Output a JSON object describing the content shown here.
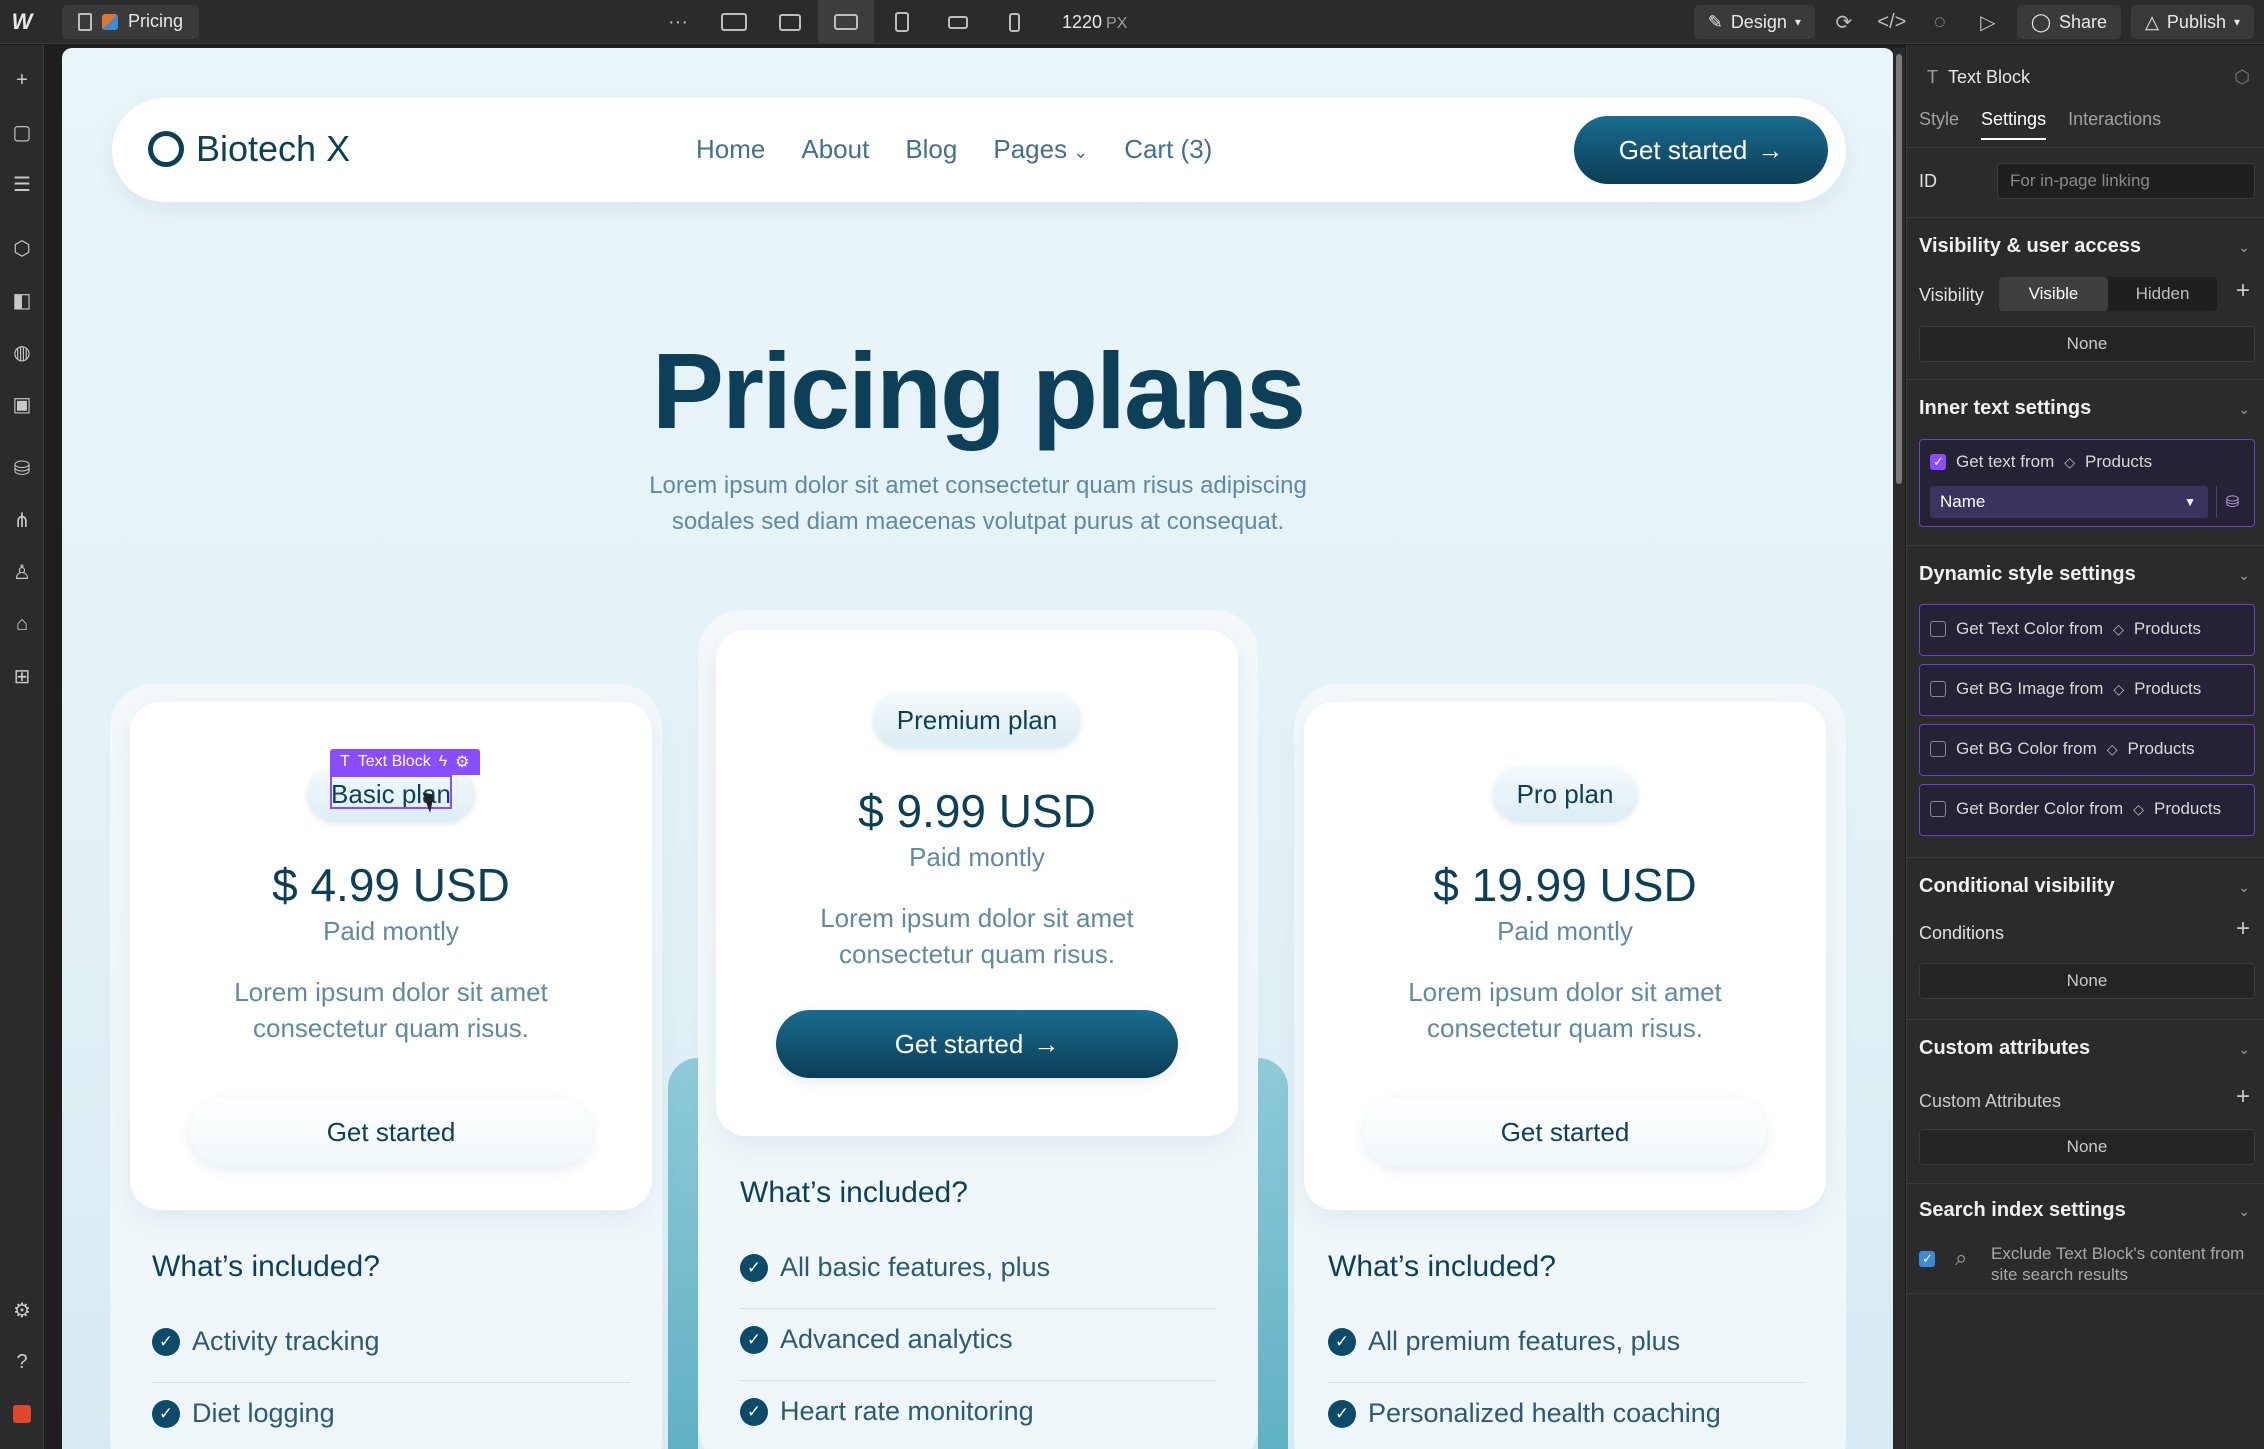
{
  "topbar": {
    "page_name": "Pricing",
    "more": "···",
    "width_value": "1220",
    "width_unit": "PX",
    "design_label": "Design",
    "share_label": "Share",
    "publish_label": "Publish"
  },
  "site": {
    "brand": "Biotech X",
    "nav": [
      "Home",
      "About",
      "Blog",
      "Pages",
      "Cart (3)"
    ],
    "nav_cta": "Get started",
    "hero_title": "Pricing plans",
    "hero_sub": "Lorem ipsum dolor sit amet consectetur quam risus adipiscing sodales sed diam maecenas volutpat purus at consequat.",
    "plans": [
      {
        "name": "Basic plan",
        "price": "$ 4.99 USD",
        "period": "Paid montly",
        "desc": "Lorem ipsum dolor sit amet consectetur quam risus.",
        "cta": "Get started"
      },
      {
        "name": "Premium plan",
        "price": "$ 9.99 USD",
        "period": "Paid montly",
        "desc": "Lorem ipsum dolor sit amet consectetur quam risus.",
        "cta": "Get started"
      },
      {
        "name": "Pro plan",
        "price": "$ 19.99 USD",
        "period": "Paid montly",
        "desc": "Lorem ipsum dolor sit amet consectetur quam risus.",
        "cta": "Get started"
      }
    ],
    "included_title": "What’s included?",
    "basic_features": [
      "Activity tracking",
      "Diet logging"
    ],
    "premium_features": [
      "All basic features, plus",
      "Advanced analytics",
      "Heart rate monitoring"
    ],
    "pro_features": [
      "All premium features, plus",
      "Personalized health coaching"
    ]
  },
  "selection": {
    "tag_label": "Text Block"
  },
  "panel": {
    "element_type": "Text Block",
    "tabs": [
      "Style",
      "Settings",
      "Interactions"
    ],
    "id_label": "ID",
    "id_placeholder": "For in-page linking",
    "visibility_section": "Visibility & user access",
    "visibility_label": "Visibility",
    "visible": "Visible",
    "hidden": "Hidden",
    "none": "None",
    "inner_text_section": "Inner text settings",
    "get_text_from": "Get text from",
    "collection": "Products",
    "field_name": "Name",
    "dynamic_section": "Dynamic style settings",
    "dynamic_items": [
      "Get Text Color from",
      "Get BG Image from",
      "Get BG Color from",
      "Get Border Color from"
    ],
    "conditional_section": "Conditional visibility",
    "conditions_label": "Conditions",
    "custom_attr_section": "Custom attributes",
    "custom_attr_label": "Custom Attributes",
    "search_section": "Search index settings",
    "search_exclude": "Exclude Text Block's content from site search results"
  },
  "colors": {
    "accent": "#8a4dff",
    "brand_dark": "#0d4058"
  }
}
